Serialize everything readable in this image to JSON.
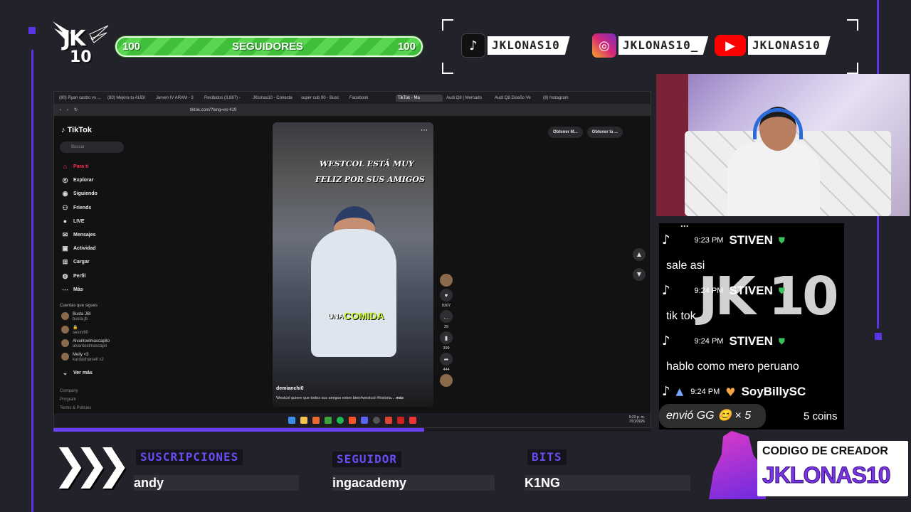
{
  "overlay": {
    "logo": {
      "jk": "JK",
      "ten": "10"
    },
    "followers_bar": {
      "left_count": "100",
      "label": "SEGUIDORES",
      "right_count": "100"
    },
    "socials": [
      {
        "icon": "tiktok-icon",
        "handle": "JKLONAS10",
        "color": "#111111"
      },
      {
        "icon": "instagram-icon",
        "handle": "JKLONAS10_",
        "color": "#d62976"
      },
      {
        "icon": "youtube-icon",
        "handle": "JKLONAS10",
        "color": "#ff0000"
      }
    ],
    "accent": "#5b34e6"
  },
  "browser": {
    "tabs": [
      "(80) Ryan castro vs ...",
      "(80) Mejora tu AUDI",
      "Jarven IV ARAM - 3",
      "Recibidos (3.887) -",
      "JKlonas10 - Conecta",
      "super cub 90 - Busc",
      "Facebook",
      "TikTok - Ma",
      "Audi Q8 | Mercado",
      "Audi Q8 Diseño Ve",
      "(8) Instagram"
    ],
    "active_tab_index": 7,
    "url": "tiktok.com/?lang=es-419",
    "tiktok": {
      "brand": "TikTok",
      "search_placeholder": "Buscar",
      "nav": [
        {
          "label": "Para ti",
          "icon": "home-icon",
          "active": true
        },
        {
          "label": "Explorar",
          "icon": "compass-icon"
        },
        {
          "label": "Siguiendo",
          "icon": "following-icon"
        },
        {
          "label": "Friends",
          "icon": "friends-icon"
        },
        {
          "label": "LIVE",
          "icon": "live-icon"
        },
        {
          "label": "Mensajes",
          "icon": "messages-icon"
        },
        {
          "label": "Actividad",
          "icon": "activity-icon"
        },
        {
          "label": "Cargar",
          "icon": "upload-icon"
        },
        {
          "label": "Perfil",
          "icon": "profile-icon"
        },
        {
          "label": "Más",
          "icon": "more-icon"
        }
      ],
      "following_title": "Cuentas que sigues",
      "following": [
        {
          "name": "Busta JBI",
          "handle": "busta.jb"
        },
        {
          "name": "🔒",
          "handle": "sexxx60"
        },
        {
          "name": "Alvaritoelmascapito",
          "handle": "alvaritoelmascapit"
        },
        {
          "name": "Melly <3",
          "handle": "kardasharsell x2"
        }
      ],
      "see_more": "Ver más",
      "footer": [
        "Company",
        "Program",
        "Terms & Policies"
      ],
      "top_buttons": [
        "Obtener M...",
        "Obtener la ..."
      ],
      "video": {
        "caption_line1": "WESTCOL ESTÁ MUY",
        "caption_line2": "FELIZ POR SUS AMIGOS",
        "subtitle_a": "UNA",
        "subtitle_b": "COMIDA",
        "username": "demianchi0",
        "description": "Westcol quiere que todos sus amigos esten bien#westcol #historia...",
        "more": "más"
      },
      "actions": [
        {
          "icon": "heart-icon",
          "count": "8307"
        },
        {
          "icon": "comment-icon",
          "count": "29"
        },
        {
          "icon": "bookmark-icon",
          "count": "399"
        },
        {
          "icon": "share-icon",
          "count": "444"
        }
      ]
    },
    "taskbar": {
      "time": "9:23 p. m.",
      "date": "7/01/2026"
    },
    "progress": 0.62
  },
  "chat": {
    "cut_top": "...",
    "messages": [
      {
        "time": "9:23 PM",
        "user": "STIVEN",
        "text": "sale asi"
      },
      {
        "time": "9:24 PM",
        "user": "STIVEN",
        "text": "tik tok"
      },
      {
        "time": "9:24 PM",
        "user": "STIVEN",
        "text": "hablo como mero peruano"
      },
      {
        "time": "9:24 PM",
        "user": "SoyBillySC",
        "text": ""
      }
    ],
    "gift_text": "envió GG 😊 × 5",
    "coins": "5 coins",
    "watermark": "JK 10"
  },
  "ticker": [
    {
      "label": "SUSCRIPCIONES",
      "value": "andy"
    },
    {
      "label": "SEGUIDOR",
      "value": "ingacademy"
    },
    {
      "label": "BITS",
      "value": "K1NG"
    }
  ],
  "creator_code": {
    "title": "CODIGO DE CREADOR",
    "code": "JKLONAS10"
  }
}
